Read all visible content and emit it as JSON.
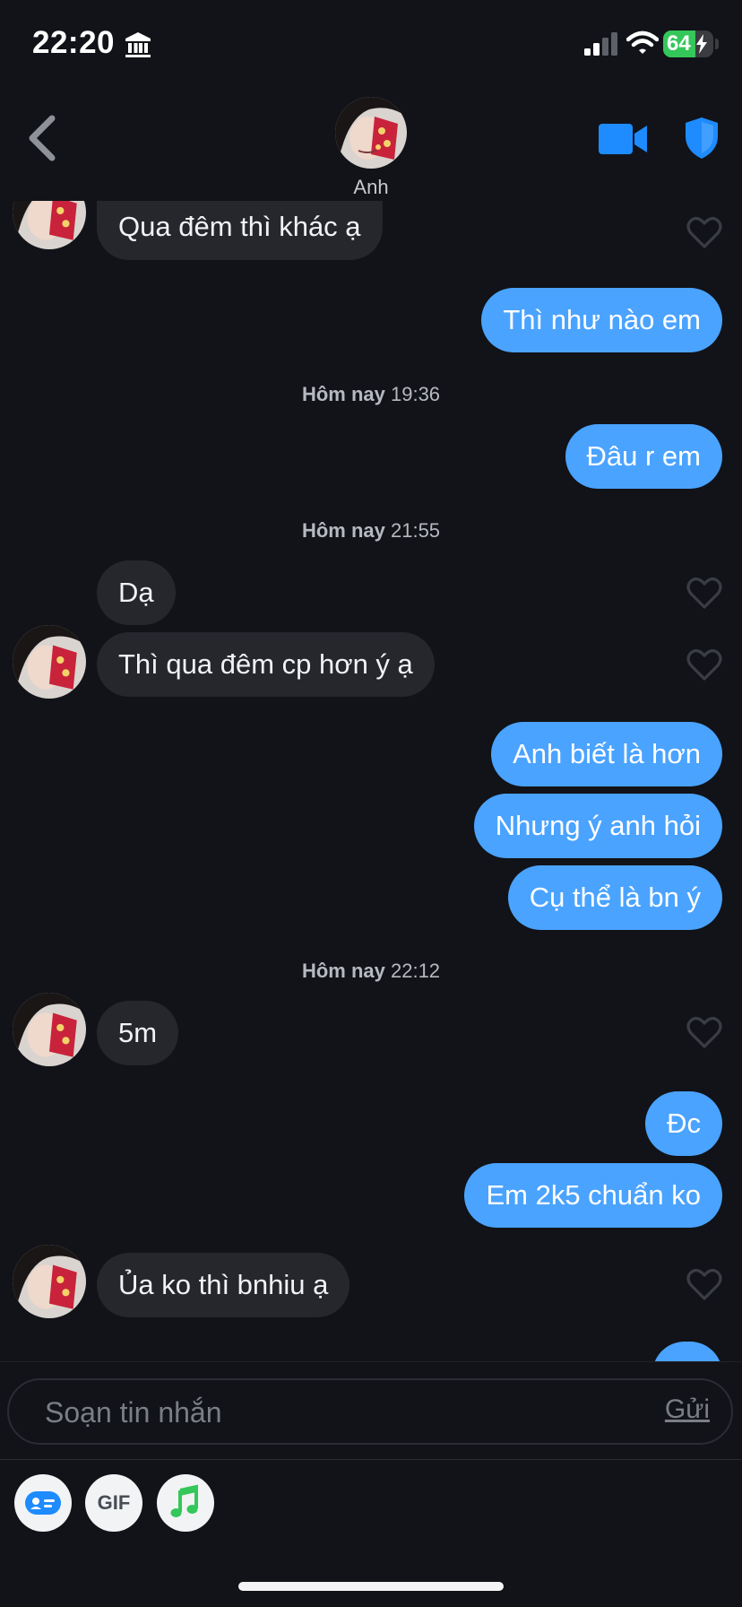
{
  "status_bar": {
    "time": "22:20",
    "battery": "64",
    "battery_level": 0.64
  },
  "header": {
    "contact_name": "Anh"
  },
  "messages": [
    {
      "text": "Qua đêm thì khác ạ"
    },
    {
      "text": "Thì như nào em"
    },
    {
      "ts_day": "Hôm nay",
      "ts_time": "19:36"
    },
    {
      "text": "Đâu r em"
    },
    {
      "ts_day": "Hôm nay",
      "ts_time": "21:55"
    },
    {
      "text": "Dạ"
    },
    {
      "text": "Thì qua đêm cp hơn ý ạ"
    },
    {
      "text": "Anh biết là hơn"
    },
    {
      "text": "Nhưng ý anh hỏi"
    },
    {
      "text": "Cụ thể là bn ý"
    },
    {
      "ts_day": "Hôm nay",
      "ts_time": "22:12"
    },
    {
      "text": "5m"
    },
    {
      "text": "Đc"
    },
    {
      "text": "Em 2k5 chuẩn ko"
    },
    {
      "text": "Ủa ko thì bnhiu ạ"
    }
  ],
  "composer": {
    "placeholder": "Soạn tin nhắn",
    "send_label": "Gửi"
  },
  "toolbar": {
    "gif_label": "GIF"
  },
  "colors": {
    "accent": "#4aa3ff",
    "incoming_bubble": "#25272d",
    "background": "#111318",
    "battery_green": "#34c759",
    "music_green": "#34c759"
  },
  "icons": [
    "bank-icon",
    "signal-icon",
    "wifi-icon",
    "back-arrow-icon",
    "video-camera-icon",
    "shield-icon",
    "heart-icon",
    "contact-card-icon",
    "music-note-icon"
  ]
}
